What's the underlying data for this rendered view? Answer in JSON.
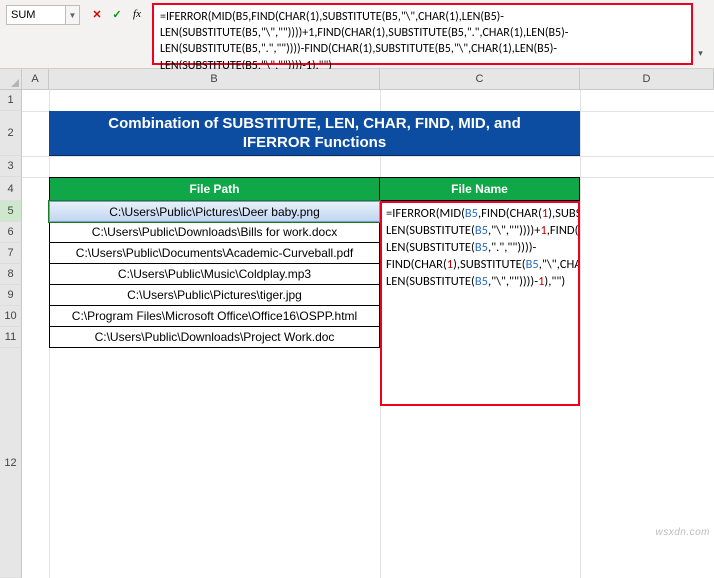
{
  "name_box": "SUM",
  "fx_label": "fx",
  "formula_bar_text": "=IFERROR(MID(B5,FIND(CHAR(1),SUBSTITUTE(B5,\"\\\",CHAR(1),LEN(B5)-LEN(SUBSTITUTE(B5,\"\\\",\"\"))))+1,FIND(CHAR(1),SUBSTITUTE(B5,\".\",CHAR(1),LEN(B5)-LEN(SUBSTITUTE(B5,\".\",\"\"))))-FIND(CHAR(1),SUBSTITUTE(B5,\"\\\",CHAR(1),LEN(B5)-LEN(SUBSTITUTE(B5,\"\\\",\"\"))))-1),\"\")",
  "columns": [
    "A",
    "B",
    "C",
    "D"
  ],
  "rows": [
    "1",
    "2",
    "3",
    "4",
    "5",
    "6",
    "7",
    "8",
    "9",
    "10",
    "11",
    "12"
  ],
  "title_banner": "Combination of SUBSTITUTE, LEN, CHAR, FIND, MID, and IFERROR Functions",
  "headers": {
    "b": "File Path",
    "c": "File Name"
  },
  "paths": [
    "C:\\Users\\Public\\Pictures\\Deer baby.png",
    "C:\\Users\\Public\\Downloads\\Bills for work.docx",
    "C:\\Users\\Public\\Documents\\Academic-Curveball.pdf",
    "C:\\Users\\Public\\Music\\Coldplay.mp3",
    "C:\\Users\\Public\\Pictures\\tiger.jpg",
    "C:\\Program Files\\Microsoft Office\\Office16\\OSPP.html",
    "C:\\Users\\Public\\Downloads\\Project Work.doc"
  ],
  "cell_formula_tokens": [
    {
      "t": "=IFERROR",
      "c": "fn"
    },
    {
      "t": "(",
      "c": "fn"
    },
    {
      "t": "MID",
      "c": "fn"
    },
    {
      "t": "(",
      "c": "fn"
    },
    {
      "t": "B5",
      "c": "ref"
    },
    {
      "t": ",",
      "c": "fn"
    },
    {
      "t": "FIND",
      "c": "fn"
    },
    {
      "t": "(",
      "c": "fn"
    },
    {
      "t": "CHAR",
      "c": "fn"
    },
    {
      "t": "(",
      "c": "fn"
    },
    {
      "t": "1",
      "c": "num"
    },
    {
      "t": "),",
      "c": "fn"
    },
    {
      "t": "SUBSTITUTE",
      "c": "fn"
    },
    {
      "t": "(",
      "c": "fn"
    },
    {
      "t": "B5",
      "c": "ref"
    },
    {
      "t": ",",
      "c": "fn"
    },
    {
      "t": "\"\\\",",
      "c": "fn"
    },
    {
      "t": "CHAR",
      "c": "fn"
    },
    {
      "t": "(",
      "c": "fn"
    },
    {
      "t": "1",
      "c": "num"
    },
    {
      "t": "),",
      "c": "fn"
    },
    {
      "t": "LEN",
      "c": "fn"
    },
    {
      "t": "(",
      "c": "fn"
    },
    {
      "t": "B5",
      "c": "ref"
    },
    {
      "t": ")-",
      "c": "fn"
    },
    {
      "t": "LEN",
      "c": "fn"
    },
    {
      "t": "(",
      "c": "fn"
    },
    {
      "t": "SUBSTITUTE",
      "c": "fn"
    },
    {
      "t": "(",
      "c": "fn"
    },
    {
      "t": "B5",
      "c": "ref"
    },
    {
      "t": ",\"\\\",\"\"))))+",
      "c": "fn"
    },
    {
      "t": "1",
      "c": "num"
    },
    {
      "t": ",",
      "c": "fn"
    },
    {
      "t": "FIND",
      "c": "fn"
    },
    {
      "t": "(",
      "c": "fn"
    },
    {
      "t": "CHAR",
      "c": "fn"
    },
    {
      "t": "(",
      "c": "fn"
    },
    {
      "t": "1",
      "c": "num"
    },
    {
      "t": "),",
      "c": "fn"
    },
    {
      "t": "SUBSTITUTE",
      "c": "fn"
    },
    {
      "t": "(",
      "c": "fn"
    },
    {
      "t": "B5",
      "c": "ref"
    },
    {
      "t": ",\".\",",
      "c": "fn"
    },
    {
      "t": "CHAR",
      "c": "fn"
    },
    {
      "t": "(",
      "c": "fn"
    },
    {
      "t": "1",
      "c": "num"
    },
    {
      "t": "),",
      "c": "fn"
    },
    {
      "t": "LEN",
      "c": "fn"
    },
    {
      "t": "(",
      "c": "fn"
    },
    {
      "t": "B5",
      "c": "ref"
    },
    {
      "t": ")-",
      "c": "fn"
    },
    {
      "t": "LEN",
      "c": "fn"
    },
    {
      "t": "(",
      "c": "fn"
    },
    {
      "t": "SUBSTITUTE",
      "c": "fn"
    },
    {
      "t": "(",
      "c": "fn"
    },
    {
      "t": "B5",
      "c": "ref"
    },
    {
      "t": ",\".\",\"\"))))-",
      "c": "fn"
    },
    {
      "t": "FIND",
      "c": "fn"
    },
    {
      "t": "(",
      "c": "fn"
    },
    {
      "t": "CHAR",
      "c": "fn"
    },
    {
      "t": "(",
      "c": "fn"
    },
    {
      "t": "1",
      "c": "num"
    },
    {
      "t": "),",
      "c": "fn"
    },
    {
      "t": "SUBSTITUTE",
      "c": "fn"
    },
    {
      "t": "(",
      "c": "fn"
    },
    {
      "t": "B5",
      "c": "ref"
    },
    {
      "t": ",\"\\\",",
      "c": "fn"
    },
    {
      "t": "CHAR",
      "c": "fn"
    },
    {
      "t": "(",
      "c": "fn"
    },
    {
      "t": "1",
      "c": "num"
    },
    {
      "t": "),",
      "c": "fn"
    },
    {
      "t": "LEN",
      "c": "fn"
    },
    {
      "t": "(",
      "c": "fn"
    },
    {
      "t": "B5",
      "c": "ref"
    },
    {
      "t": ")-",
      "c": "fn"
    },
    {
      "t": "LEN",
      "c": "fn"
    },
    {
      "t": "(",
      "c": "fn"
    },
    {
      "t": "SUBSTITUTE",
      "c": "fn"
    },
    {
      "t": "(",
      "c": "fn"
    },
    {
      "t": "B5",
      "c": "ref"
    },
    {
      "t": ",\"\\\",\"\"))))-",
      "c": "fn"
    },
    {
      "t": "1",
      "c": "num"
    },
    {
      "t": "),",
      "c": "fn"
    },
    {
      "t": "\"\")",
      "c": "fn"
    }
  ],
  "watermark": "wsxdn.com"
}
